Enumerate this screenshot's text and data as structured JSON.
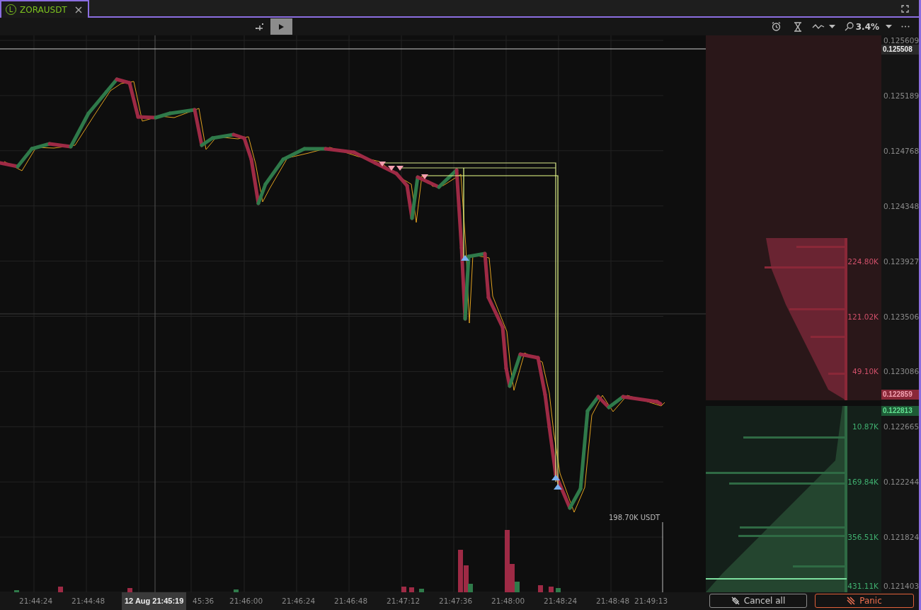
{
  "tab": {
    "badge": "L",
    "symbol": "ZORAUSDT",
    "selected": true
  },
  "toolbar": {
    "zoom": "3.4%"
  },
  "price_axis": [
    "0.125609",
    "0.125189",
    "0.124768",
    "0.124348",
    "0.123927",
    "0.123506",
    "0.123086",
    "0.122665",
    "0.122244",
    "0.121824",
    "0.121403"
  ],
  "last_price": "0.125508",
  "best_ask": "0.122859",
  "best_bid": "0.122813",
  "order_book": {
    "ask_volumes": [
      "224.80K",
      "121.02K",
      "49.10K"
    ],
    "bid_volumes": [
      "10.87K",
      "169.84K",
      "356.51K",
      "431.11K"
    ]
  },
  "volume_label": "198.70K USDT",
  "time_axis": [
    "21:44:24",
    "21:44:48",
    "45:36",
    "21:46:00",
    "21:46:24",
    "21:46:48",
    "21:47:12",
    "21:47:36",
    "21:48:00",
    "21:48:24",
    "21:48:48",
    "21:49:13"
  ],
  "crosshair_time": "12 Aug 21:45:19",
  "buttons": [
    {
      "kind": "cancel",
      "label": "Cancel all"
    },
    {
      "kind": "panic",
      "label": "Panic"
    }
  ]
}
